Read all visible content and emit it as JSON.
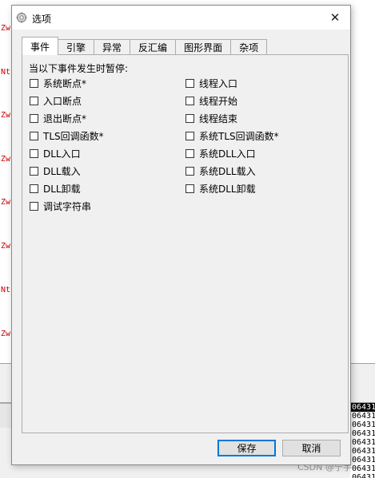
{
  "background": {
    "gutter_labels": [
      "Zw",
      "Nt",
      "Zw",
      "Zw",
      "Zw",
      "Zw",
      "Nt",
      "Zw"
    ],
    "hex_column": [
      "06431",
      "06431",
      "06431",
      "06431",
      "06431",
      "06431",
      "06431",
      "06431",
      "06431"
    ],
    "watermark": "CSDN @宁宇"
  },
  "dialog": {
    "title": "选项",
    "close_glyph": "✕",
    "tabs": [
      {
        "label": "事件",
        "active": true
      },
      {
        "label": "引擎",
        "active": false
      },
      {
        "label": "异常",
        "active": false
      },
      {
        "label": "反汇编",
        "active": false
      },
      {
        "label": "图形界面",
        "active": false
      },
      {
        "label": "杂项",
        "active": false
      }
    ],
    "prompt": "当以下事件发生时暂停:",
    "left_checkboxes": [
      {
        "label": "系统断点*",
        "checked": false
      },
      {
        "label": "入口断点",
        "checked": false
      },
      {
        "label": "退出断点*",
        "checked": false
      },
      {
        "label": "TLS回调函数*",
        "checked": false
      },
      {
        "label": "DLL入口",
        "checked": false
      },
      {
        "label": "DLL载入",
        "checked": false
      },
      {
        "label": "DLL卸载",
        "checked": false
      },
      {
        "label": "调试字符串",
        "checked": false
      }
    ],
    "right_checkboxes": [
      {
        "label": "线程入口",
        "checked": false
      },
      {
        "label": "线程开始",
        "checked": false
      },
      {
        "label": "线程结束",
        "checked": false
      },
      {
        "label": "系统TLS回调函数*",
        "checked": false
      },
      {
        "label": "系统DLL入口",
        "checked": false
      },
      {
        "label": "系统DLL载入",
        "checked": false
      },
      {
        "label": "系统DLL卸载",
        "checked": false
      }
    ],
    "save_label": "保存",
    "cancel_label": "取消"
  },
  "colors": {
    "accent": "#0078d7",
    "dialog_bg": "#f0f0f0",
    "gutter_text": "#cc0000"
  }
}
